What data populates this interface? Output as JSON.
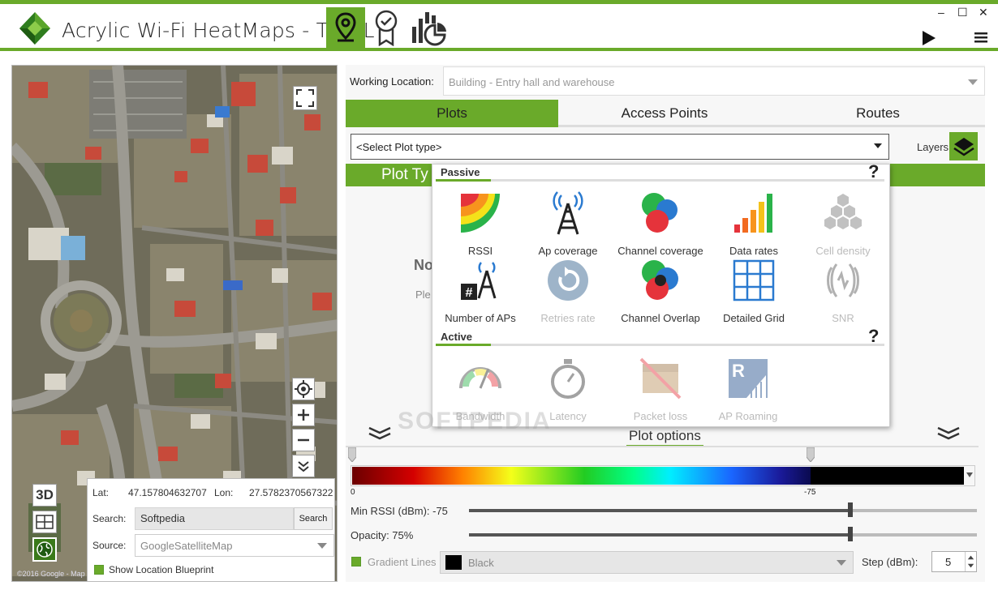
{
  "app": {
    "title": "Acrylic Wi-Fi HeatMaps - TRIAL",
    "window_controls": [
      "–",
      "☐",
      "✕"
    ],
    "top_tabs": [
      "map-pin-icon",
      "award-ribbon-icon",
      "statistics-chart-icon"
    ]
  },
  "map": {
    "copyright": "©2016 Google - Map",
    "btn_3d": "3D",
    "lat_label": "Lat:",
    "lat_value": "47.157804632707",
    "lon_label": "Lon:",
    "lon_value": "27.5782370567322",
    "search_label": "Search:",
    "search_value": "Softpedia",
    "search_button": "Search",
    "source_label": "Source:",
    "source_value": "GoogleSatelliteMap",
    "show_blueprint": "Show Location Blueprint"
  },
  "working_location": {
    "label": "Working Location:",
    "value": "Building - Entry hall and warehouse"
  },
  "tabs": [
    "Plots",
    "Access Points",
    "Routes"
  ],
  "plot_type": {
    "placeholder": "<Select Plot type>",
    "layers_label": "Layers",
    "header_partial": "Plot Ty",
    "no_plot_partial": "No",
    "please_partial": "Ple"
  },
  "popup": {
    "passive_title": "Passive",
    "active_title": "Active",
    "help": "?",
    "passive_items": [
      {
        "label": "RSSI",
        "enabled": true
      },
      {
        "label": "Ap coverage",
        "enabled": true
      },
      {
        "label": "Channel coverage",
        "enabled": true
      },
      {
        "label": "Data rates",
        "enabled": true
      },
      {
        "label": "Cell density",
        "enabled": false
      },
      {
        "label": "Number of APs",
        "enabled": true
      },
      {
        "label": "Retries rate",
        "enabled": false
      },
      {
        "label": "Channel Overlap",
        "enabled": true
      },
      {
        "label": "Detailed Grid",
        "enabled": true
      },
      {
        "label": "SNR",
        "enabled": false
      }
    ],
    "active_items": [
      {
        "label": "Bandwidth",
        "enabled": false
      },
      {
        "label": "Latency",
        "enabled": false
      },
      {
        "label": "Packet loss",
        "enabled": false
      },
      {
        "label": "AP Roaming",
        "enabled": false
      }
    ]
  },
  "plot_options": {
    "title": "Plot options",
    "gradient_ticks": [
      "0",
      "-75"
    ],
    "min_rssi_label": "Min RSSI (dBm): -75",
    "min_rssi_value": -75,
    "opacity_label": "Opacity: 75%",
    "opacity_value": 75,
    "gradient_lines_label": "Gradient Lines",
    "line_color": "Black",
    "step_label": "Step (dBm):",
    "step_value": "5"
  },
  "watermark": "SOFTPEDIA",
  "colors": {
    "accent": "#6aaa2a"
  }
}
